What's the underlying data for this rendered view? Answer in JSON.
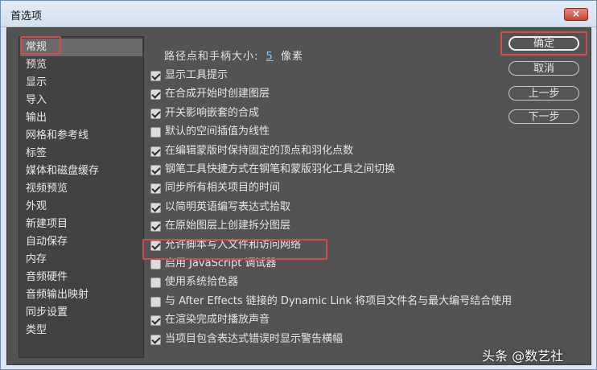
{
  "window": {
    "title": "首选项",
    "close_label": "×"
  },
  "sidebar": {
    "selected_index": 0,
    "items": [
      {
        "label": "常规"
      },
      {
        "label": "预览"
      },
      {
        "label": "显示"
      },
      {
        "label": "导入"
      },
      {
        "label": "输出"
      },
      {
        "label": "网格和参考线"
      },
      {
        "label": "标签"
      },
      {
        "label": "媒体和磁盘缓存"
      },
      {
        "label": "视频预览"
      },
      {
        "label": "外观"
      },
      {
        "label": "新建项目"
      },
      {
        "label": "自动保存"
      },
      {
        "label": "内存"
      },
      {
        "label": "音频硬件"
      },
      {
        "label": "音频输出映射"
      },
      {
        "label": "同步设置"
      },
      {
        "label": "类型"
      }
    ]
  },
  "general": {
    "path_label": "路径点和手柄大小:",
    "path_value": "5",
    "path_unit": "像素",
    "options": [
      {
        "label": "显示工具提示",
        "checked": true
      },
      {
        "label": "在合成开始时创建图层",
        "checked": true
      },
      {
        "label": "开关影响嵌套的合成",
        "checked": true
      },
      {
        "label": "默认的空间插值为线性",
        "checked": false
      },
      {
        "label": "在编辑蒙版时保持固定的顶点和羽化点数",
        "checked": true
      },
      {
        "label": "钢笔工具快捷方式在钢笔和蒙版羽化工具之间切换",
        "checked": true
      },
      {
        "label": "同步所有相关项目的时间",
        "checked": true
      },
      {
        "label": "以简明英语编写表达式拾取",
        "checked": true
      },
      {
        "label": "在原始图层上创建拆分图层",
        "checked": true
      },
      {
        "label": "允许脚本写入文件和访问网络",
        "checked": true
      },
      {
        "label": "启用 JavaScript 调试器",
        "checked": false
      },
      {
        "label": "使用系统拾色器",
        "checked": false
      },
      {
        "label": "与 After Effects 链接的 Dynamic Link 将项目文件名与最大编号结合使用",
        "checked": false
      },
      {
        "label": "在渲染完成时播放声音",
        "checked": true
      },
      {
        "label": "当项目包含表达式错误时显示警告横幅",
        "checked": true
      }
    ]
  },
  "buttons": {
    "ok": "确定",
    "cancel": "取消",
    "prev": "上一步",
    "next": "下一步"
  },
  "watermark": "头条 @数艺社",
  "colors": {
    "panel_bg": "#535353",
    "sidebar_bg": "#424242",
    "selected_bg": "#6b6b6b",
    "highlight_box": "#d24a4a",
    "link_value": "#8ec3f0"
  }
}
